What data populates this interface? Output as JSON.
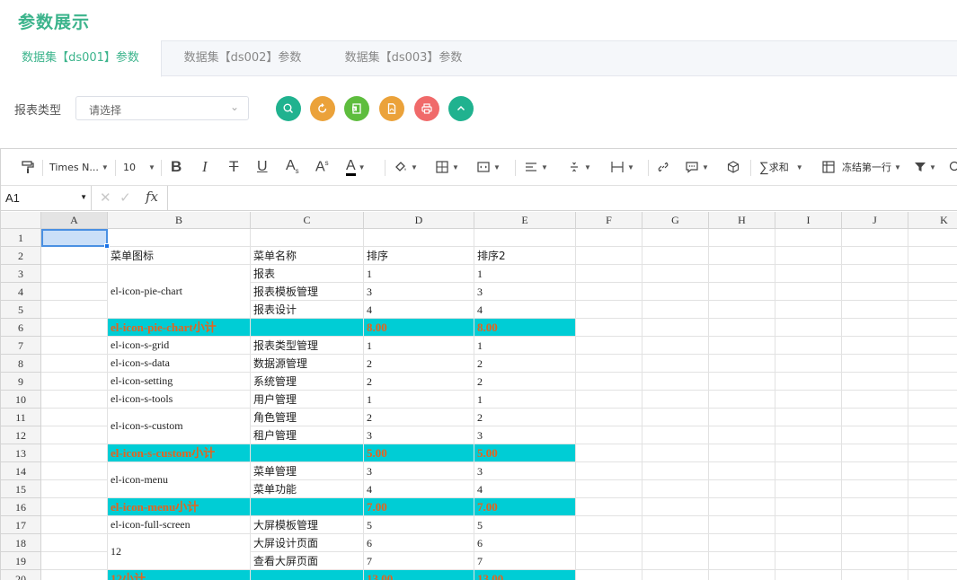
{
  "page": {
    "title": "参数展示"
  },
  "tabs": [
    {
      "label": "数据集【ds001】参数",
      "active": true
    },
    {
      "label": "数据集【ds002】参数",
      "active": false
    },
    {
      "label": "数据集【ds003】参数",
      "active": false
    }
  ],
  "filter": {
    "label": "报表类型",
    "placeholder": "请选择"
  },
  "actions": [
    {
      "name": "search-button",
      "icon": "search-icon",
      "color": "#20b28f"
    },
    {
      "name": "reset-button",
      "icon": "refresh-icon",
      "color": "#eba23a"
    },
    {
      "name": "export-excel-button",
      "icon": "excel-icon",
      "color": "#5ebd3e"
    },
    {
      "name": "export-pdf-button",
      "icon": "pdf-icon",
      "color": "#eba23a"
    },
    {
      "name": "print-button",
      "icon": "print-icon",
      "color": "#f06a6a"
    },
    {
      "name": "collapse-button",
      "icon": "chevron-up-icon",
      "color": "#20b28f"
    }
  ],
  "toolbar": {
    "font_family": "Times N...",
    "font_size": "10",
    "sum_label": "求和",
    "freeze_label": "冻结第一行"
  },
  "formula": {
    "cell_ref": "A1"
  },
  "columns": [
    "A",
    "B",
    "C",
    "D",
    "E",
    "F",
    "G",
    "H",
    "I",
    "J",
    "K"
  ],
  "rows": [
    "1",
    "2",
    "3",
    "4",
    "5",
    "6",
    "7",
    "8",
    "9",
    "10",
    "11",
    "12",
    "13",
    "14",
    "15",
    "16",
    "17",
    "18",
    "19",
    "20"
  ],
  "header_row": {
    "b": "菜单图标",
    "c": "菜单名称",
    "d": "排序",
    "e": "排序2"
  },
  "groups": [
    {
      "icon": "el-icon-pie-chart",
      "items": [
        {
          "c": "报表",
          "d": "1",
          "e": "1"
        },
        {
          "c": "报表模板管理",
          "d": "3",
          "e": "3"
        },
        {
          "c": "报表设计",
          "d": "4",
          "e": "4"
        }
      ]
    },
    {
      "subtotal": true,
      "b": "el-icon-pie-chart小计",
      "d": "8.00",
      "e": "8.00"
    },
    {
      "icon": "el-icon-s-grid",
      "items": [
        {
          "c": "报表类型管理",
          "d": "1",
          "e": "1"
        }
      ]
    },
    {
      "icon": "el-icon-s-data",
      "items": [
        {
          "c": "数据源管理",
          "d": "2",
          "e": "2"
        }
      ]
    },
    {
      "icon": "el-icon-setting",
      "items": [
        {
          "c": "系统管理",
          "d": "2",
          "e": "2"
        }
      ]
    },
    {
      "icon": "el-icon-s-tools",
      "items": [
        {
          "c": "用户管理",
          "d": "1",
          "e": "1"
        }
      ]
    },
    {
      "icon": "el-icon-s-custom",
      "items": [
        {
          "c": "角色管理",
          "d": "2",
          "e": "2"
        },
        {
          "c": "租户管理",
          "d": "3",
          "e": "3"
        }
      ]
    },
    {
      "subtotal": true,
      "b": "el-icon-s-custom小计",
      "d": "5.00",
      "e": "5.00"
    },
    {
      "icon": "el-icon-menu",
      "items": [
        {
          "c": "菜单管理",
          "d": "3",
          "e": "3"
        },
        {
          "c": "菜单功能",
          "d": "4",
          "e": "4"
        }
      ]
    },
    {
      "subtotal": true,
      "b": "el-icon-menu小计",
      "d": "7.00",
      "e": "7.00"
    },
    {
      "icon": "el-icon-full-screen",
      "items": [
        {
          "c": "大屏模板管理",
          "d": "5",
          "e": "5"
        }
      ]
    },
    {
      "icon": "12",
      "items": [
        {
          "c": "大屏设计页面",
          "d": "6",
          "e": "6"
        },
        {
          "c": "查看大屏页面",
          "d": "7",
          "e": "7"
        }
      ]
    },
    {
      "subtotal": true,
      "b": "12小计",
      "d": "13.00",
      "e": "13.00"
    }
  ]
}
